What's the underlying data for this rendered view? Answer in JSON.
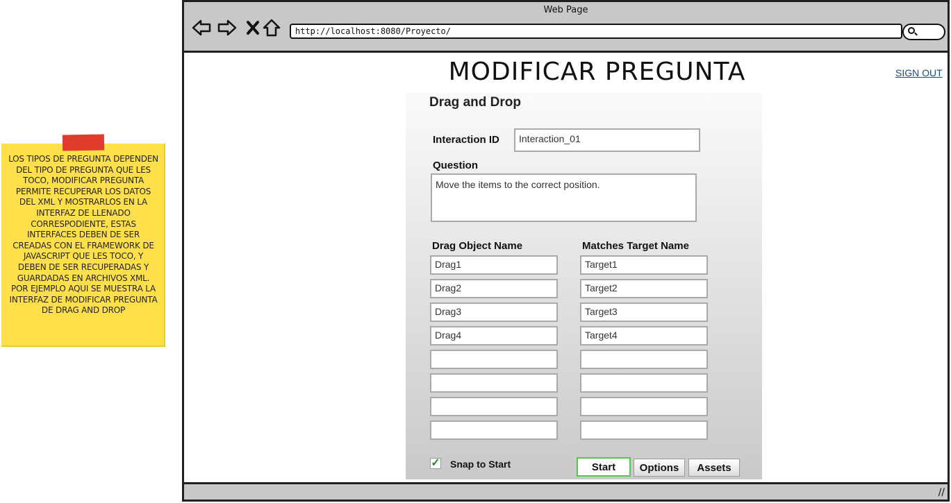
{
  "note": {
    "text": "LOS TIPOS DE PREGUNTA DEPENDEN DEL TIPO DE PREGUNTA QUE LES TOCO, MODIFICAR PREGUNTA PERMITE RECUPERAR LOS DATOS DEL XML Y MOSTRARLOS EN LA INTERFAZ DE LLENADO CORRESPODIENTE, ESTAS INTERFACES DEBEN DE SER CREADAS CON EL FRAMEWORK DE JAVASCRIPT QUE LES TOCO, Y DEBEN DE SER RECUPERADAS Y GUARDADAS EN ARCHIVOS XML. POR EJEMPLO AQUI SE MUESTRA LA INTERFAZ DE MODIFICAR PREGUNTA DE DRAG AND DROP",
    "color": "#ffe04a"
  },
  "window": {
    "title": "Web Page",
    "url": "http://localhost:8080/Proyecto/",
    "nav_icons": [
      "back-arrow-icon",
      "forward-arrow-icon",
      "stop-icon",
      "home-icon",
      "search-icon"
    ]
  },
  "page": {
    "title": "MODIFICAR PREGUNTA",
    "signout": "SIGN OUT"
  },
  "form": {
    "heading": "Drag and Drop",
    "interaction_id_label": "Interaction ID",
    "interaction_id_value": "Interaction_01",
    "question_label": "Question",
    "question_value": "Move the items to the correct position.",
    "drag_header": "Drag Object Name",
    "target_header": "Matches Target Name",
    "drags": [
      "Drag1",
      "Drag2",
      "Drag3",
      "Drag4",
      "",
      "",
      "",
      ""
    ],
    "targets": [
      "Target1",
      "Target2",
      "Target3",
      "Target4",
      "",
      "",
      "",
      ""
    ],
    "snap_label": "Snap to Start",
    "snap_checked": true,
    "tabs": [
      "Start",
      "Options",
      "Assets"
    ],
    "active_tab": "Start",
    "accent": "#55c748"
  }
}
